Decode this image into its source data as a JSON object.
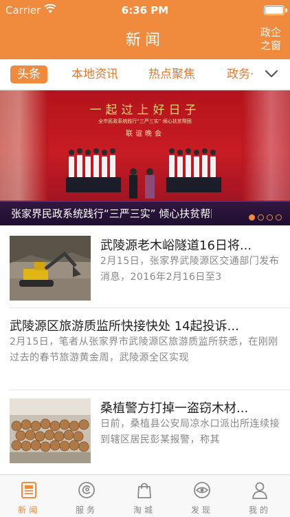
{
  "status_bar": {
    "carrier": "Carrier",
    "time": "6:36 PM"
  },
  "nav": {
    "title": "新闻",
    "right_button": "政企之窗"
  },
  "category_tabs": [
    {
      "label": "头条",
      "active": true
    },
    {
      "label": "本地资讯",
      "active": false
    },
    {
      "label": "热点聚焦",
      "active": false
    },
    {
      "label": "政务·",
      "active": false
    }
  ],
  "banner": {
    "slogan": "一起过上好日子",
    "subtitle": "全市民政系统践行“三严三实” 倾心扶贫帮困",
    "event": "联谊晚会",
    "caption": "张家界民政系统践行“三严三实” 倾心扶贫帮困...",
    "slide_count": 4,
    "active_slide": 1
  },
  "news": [
    {
      "title": "武陵源老木峪隧道16日将...",
      "summary": "2月15日，张家界武陵源区交通部门发布消息，2016年2月16日至3",
      "image": "excavator-photo"
    },
    {
      "title": "武陵源区旅游质监所快接快处 14起投诉...",
      "summary": "2月15日，笔者从张家界市武陵源区旅游质监所获悉，在刚刚过去的春节旅游黄金周，武陵源全区实现",
      "image": null
    },
    {
      "title": "桑植警方打掉一盗窃木材...",
      "summary": "日前，桑植县公安局凉水口派出所连续接到辖区居民彭某报警，称其",
      "image": "logs-photo"
    }
  ],
  "tab_bar": [
    {
      "label": "新闻",
      "icon": "newspaper-icon",
      "active": true
    },
    {
      "label": "服务",
      "icon": "service-icon",
      "active": false
    },
    {
      "label": "淘城",
      "icon": "shopping-bag-icon",
      "active": false
    },
    {
      "label": "发现",
      "icon": "discover-eye-icon",
      "active": false
    },
    {
      "label": "我的",
      "icon": "user-icon",
      "active": false
    }
  ],
  "colors": {
    "accent": "#f08a3c",
    "text": "#222222",
    "muted": "#888888"
  }
}
